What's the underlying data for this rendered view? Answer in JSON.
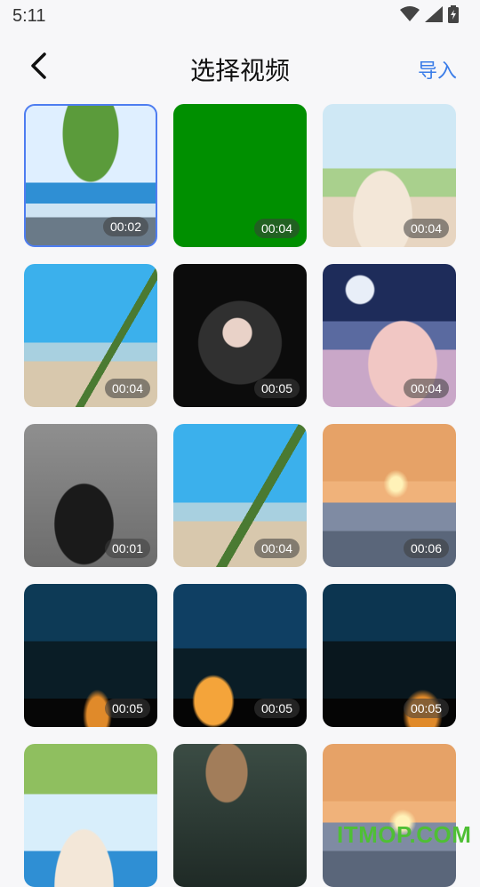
{
  "status_bar": {
    "time": "5:11",
    "icons": [
      "wifi-icon",
      "signal-icon",
      "battery-icon"
    ]
  },
  "header": {
    "back_icon": "chevron-left-icon",
    "title": "选择视频",
    "import_label": "导入",
    "accent_color": "#3b7de8"
  },
  "videos": [
    {
      "duration": "00:02",
      "selected": true
    },
    {
      "duration": "00:04",
      "selected": false
    },
    {
      "duration": "00:04",
      "selected": false
    },
    {
      "duration": "00:04",
      "selected": false
    },
    {
      "duration": "00:05",
      "selected": false
    },
    {
      "duration": "00:04",
      "selected": false
    },
    {
      "duration": "00:01",
      "selected": false
    },
    {
      "duration": "00:04",
      "selected": false
    },
    {
      "duration": "00:06",
      "selected": false
    },
    {
      "duration": "00:05",
      "selected": false
    },
    {
      "duration": "00:05",
      "selected": false
    },
    {
      "duration": "00:05",
      "selected": false
    },
    {
      "duration": "",
      "selected": false
    },
    {
      "duration": "",
      "selected": false
    },
    {
      "duration": "",
      "selected": false
    }
  ],
  "watermark": "ITMOP.COM"
}
